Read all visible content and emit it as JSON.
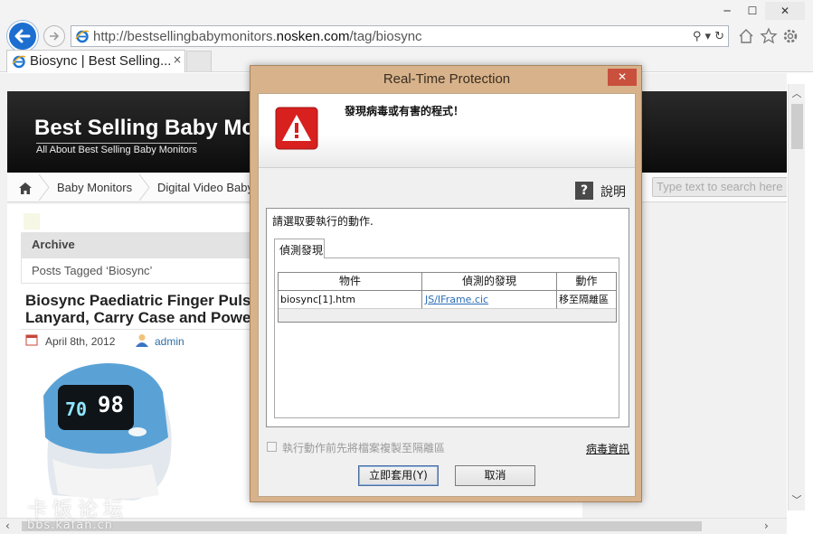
{
  "browser": {
    "url_prefix": "http://bestsellingbabymonitors.",
    "url_domain": "nosken.com",
    "url_path": "/tag/biosync",
    "tab_title": "Biosync | Best Selling...",
    "tab_close": "×",
    "win_min": "─",
    "win_max": "☐",
    "win_close": "✕",
    "addr_tools": [
      "⚲ ▾",
      "↻"
    ],
    "icons": [
      "back-arrow-icon",
      "forward-arrow-icon",
      "ie-logo-icon",
      "search-icon",
      "refresh-icon",
      "home-icon",
      "favorites-star-icon",
      "gear-icon"
    ]
  },
  "site": {
    "title": "Best Selling Baby Mo",
    "tagline": "All About Best Selling Baby Monitors",
    "nav": {
      "baby_monitors": "Baby Monitors",
      "digital_video": "Digital Video Baby"
    },
    "search_placeholder": "Type text to search here"
  },
  "content": {
    "archive_label": "Archive",
    "tag_label": "Posts Tagged ‘Biosync’",
    "post_title": "Biosync Paediatric Finger Pulse\nLanyard, Carry Case and Powe",
    "post_date": "April 8th, 2012",
    "post_author": "admin",
    "device_display": [
      "70",
      "98"
    ]
  },
  "scrollbars": {
    "up": "︿",
    "down": "﹀",
    "left": "‹",
    "right": "›"
  },
  "watermark": {
    "text_cn": "卡饭论坛",
    "url": "bbs.kafan.cn"
  },
  "dialog": {
    "title": "Real-Time Protection",
    "close": "✕",
    "warning_message": "發現病毒或有害的程式！",
    "help_label": "說明",
    "help_glyph": "?",
    "instruction": "請選取要執行的動作.",
    "tab_label": "偵測發現",
    "table": {
      "headers": [
        "物件",
        "偵測的發現",
        "動作"
      ],
      "rows": [
        {
          "object": "biosync[1].htm",
          "finding": "JS/IFrame.cic",
          "action": "移至隔離區"
        }
      ]
    },
    "copy_option": "執行動作前先將檔案複製至隔離區",
    "virus_info_link": "病毒資訊",
    "apply_button": "立即套用(Y)",
    "cancel_button": "取消"
  },
  "colors": {
    "dialog_frame": "#d7b28a",
    "close_red": "#c8503d",
    "link_blue": "#2a6db5",
    "ie_back_blue": "#1c6fd0",
    "warn_red": "#d8201f",
    "site_header_black": "#111111"
  }
}
